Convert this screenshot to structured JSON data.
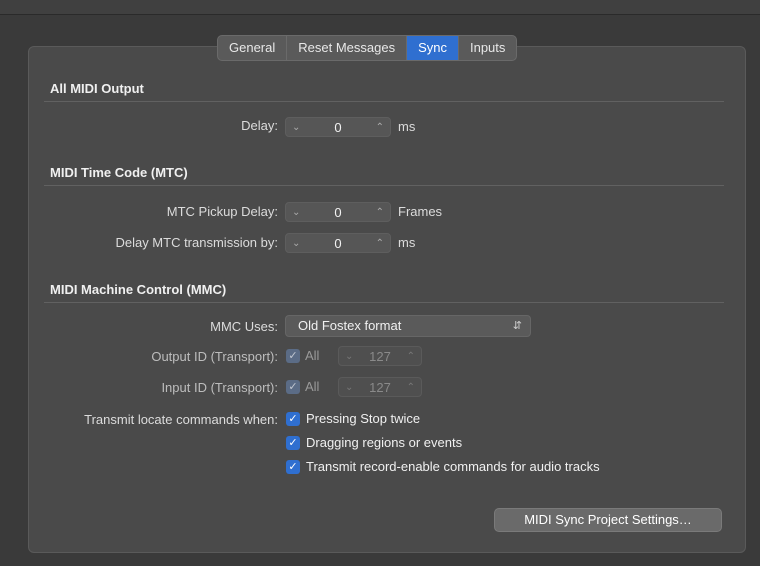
{
  "tabs": {
    "general": "General",
    "reset": "Reset Messages",
    "sync": "Sync",
    "inputs": "Inputs"
  },
  "all_midi_output": {
    "title": "All MIDI Output",
    "delay_label": "Delay:",
    "delay_value": "0",
    "delay_unit": "ms"
  },
  "mtc": {
    "title": "MIDI Time Code (MTC)",
    "pickup_label": "MTC Pickup Delay:",
    "pickup_value": "0",
    "pickup_unit": "Frames",
    "transmit_label": "Delay MTC transmission by:",
    "transmit_value": "0",
    "transmit_unit": "ms"
  },
  "mmc": {
    "title": "MIDI Machine Control (MMC)",
    "uses_label": "MMC Uses:",
    "uses_value": "Old Fostex format",
    "output_label": "Output ID (Transport):",
    "output_all": "All",
    "output_value": "127",
    "input_label": "Input ID (Transport):",
    "input_all": "All",
    "input_value": "127",
    "transmit_when_label": "Transmit locate commands when:",
    "options": [
      "Pressing Stop twice",
      "Dragging regions or events",
      "Transmit record-enable commands for audio tracks"
    ]
  },
  "project_settings_button": "MIDI Sync Project Settings…",
  "accent_color": "#2f6fd0"
}
